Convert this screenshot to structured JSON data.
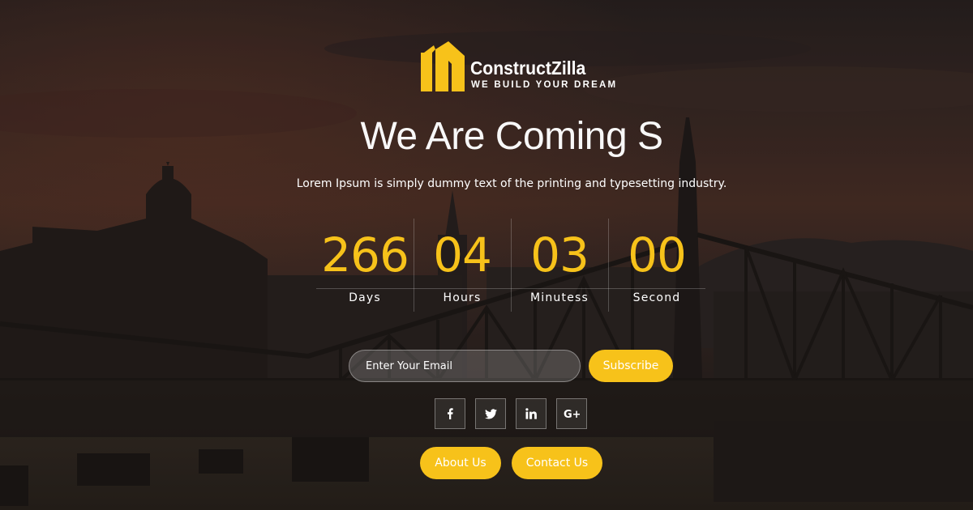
{
  "brand": {
    "name": "ConstructZilla",
    "tagline": "WE BUILD YOUR DREAM",
    "accent_color": "#f7c21a"
  },
  "hero": {
    "headline": "We Are Coming S",
    "subtext": "Lorem Ipsum is simply dummy text of the printing and typesetting industry."
  },
  "countdown": [
    {
      "value": "266",
      "label": "Days"
    },
    {
      "value": "04",
      "label": "Hours"
    },
    {
      "value": "03",
      "label": "Minutess"
    },
    {
      "value": "00",
      "label": "Second"
    }
  ],
  "subscribe": {
    "placeholder": "Enter Your Email",
    "button_label": "Subscribe"
  },
  "socials": [
    {
      "icon": "facebook-icon"
    },
    {
      "icon": "twitter-icon"
    },
    {
      "icon": "linkedin-icon"
    },
    {
      "icon": "google-plus-icon"
    }
  ],
  "footer_buttons": {
    "about_label": "About Us",
    "contact_label": "Contact Us"
  }
}
